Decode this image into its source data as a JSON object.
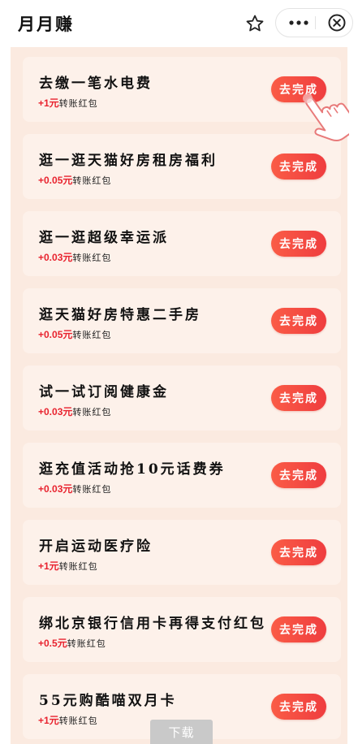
{
  "header": {
    "title": "月月赚",
    "star_icon": "star-outline-icon",
    "more_icon": "more-dots-icon",
    "close_icon": "close-circle-icon"
  },
  "colors": {
    "background": "#fbeae0",
    "card": "#fdf1ea",
    "button": "#f24a40",
    "reward_amount": "#e8222e"
  },
  "tasks": [
    {
      "title": "去缴一笔水电费",
      "amount": "+1元",
      "suffix": "转账红包",
      "button": "去完成"
    },
    {
      "title": "逛一逛天猫好房租房福利",
      "amount": "+0.05元",
      "suffix": "转账红包",
      "button": "去完成"
    },
    {
      "title": "逛一逛超级幸运派",
      "amount": "+0.03元",
      "suffix": "转账红包",
      "button": "去完成"
    },
    {
      "title": "逛天猫好房特惠二手房",
      "amount": "+0.05元",
      "suffix": "转账红包",
      "button": "去完成"
    },
    {
      "title": "试一试订阅健康金",
      "amount": "+0.03元",
      "suffix": "转账红包",
      "button": "去完成"
    },
    {
      "title": "逛充值活动抢10元话费券",
      "amount": "+0.03元",
      "suffix": "转账红包",
      "button": "去完成"
    },
    {
      "title": "开启运动医疗险",
      "amount": "+1元",
      "suffix": "转账红包",
      "button": "去完成"
    },
    {
      "title": "绑北京银行信用卡再得支付红包",
      "amount": "+0.5元",
      "suffix": "转账红包",
      "button": "去完成"
    },
    {
      "title": "55元购酷喵双月卡",
      "amount": "+1元",
      "suffix": "转账红包",
      "button": "去完成"
    }
  ],
  "download": {
    "label": "下载"
  }
}
